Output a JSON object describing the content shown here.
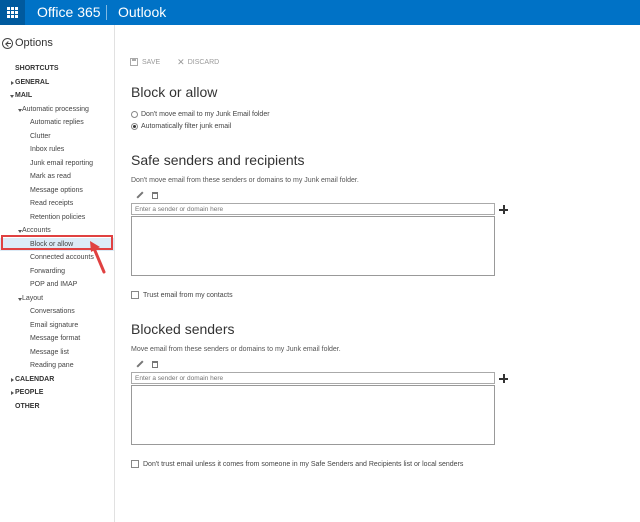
{
  "header": {
    "brand": "Office 365",
    "app": "Outlook"
  },
  "sidebar": {
    "title": "Options",
    "items": [
      {
        "label": "SHORTCUTS",
        "level": 0,
        "toggle": "none"
      },
      {
        "label": "GENERAL",
        "level": 0,
        "toggle": "right"
      },
      {
        "label": "MAIL",
        "level": 0,
        "toggle": "down"
      },
      {
        "label": "Automatic processing",
        "level": 1,
        "toggle": "down"
      },
      {
        "label": "Automatic replies",
        "level": 2
      },
      {
        "label": "Clutter",
        "level": 2
      },
      {
        "label": "Inbox rules",
        "level": 2
      },
      {
        "label": "Junk email reporting",
        "level": 2
      },
      {
        "label": "Mark as read",
        "level": 2
      },
      {
        "label": "Message options",
        "level": 2
      },
      {
        "label": "Read receipts",
        "level": 2
      },
      {
        "label": "Retention policies",
        "level": 2
      },
      {
        "label": "Accounts",
        "level": 1,
        "toggle": "down"
      },
      {
        "label": "Block or allow",
        "level": 2,
        "selected": true
      },
      {
        "label": "Connected accounts",
        "level": 2
      },
      {
        "label": "Forwarding",
        "level": 2
      },
      {
        "label": "POP and IMAP",
        "level": 2
      },
      {
        "label": "Layout",
        "level": 1,
        "toggle": "down"
      },
      {
        "label": "Conversations",
        "level": 2
      },
      {
        "label": "Email signature",
        "level": 2
      },
      {
        "label": "Message format",
        "level": 2
      },
      {
        "label": "Message list",
        "level": 2
      },
      {
        "label": "Reading pane",
        "level": 2
      },
      {
        "label": "CALENDAR",
        "level": 0,
        "toggle": "right"
      },
      {
        "label": "PEOPLE",
        "level": 0,
        "toggle": "right"
      },
      {
        "label": "OTHER",
        "level": 0,
        "toggle": "none"
      }
    ]
  },
  "toolbar": {
    "save_label": "SAVE",
    "discard_label": "DISCARD"
  },
  "block_allow": {
    "title": "Block or allow",
    "option_dont_move": "Don't move email to my Junk Email folder",
    "option_auto_filter": "Automatically filter junk email"
  },
  "safe": {
    "title": "Safe senders and recipients",
    "desc": "Don't move email from these senders or domains to my Junk email folder.",
    "placeholder": "Enter a sender or domain here",
    "trust_label": "Trust email from my contacts"
  },
  "blocked": {
    "title": "Blocked senders",
    "desc": "Move email from these senders or domains to my Junk email folder.",
    "placeholder": "Enter a sender or domain here",
    "dont_trust_label": "Don't trust email unless it comes from someone in my Safe Senders and Recipients list or local senders"
  },
  "colors": {
    "topbar": "#0072c6",
    "annotation": "#e04141",
    "selected": "#dcebf7"
  }
}
